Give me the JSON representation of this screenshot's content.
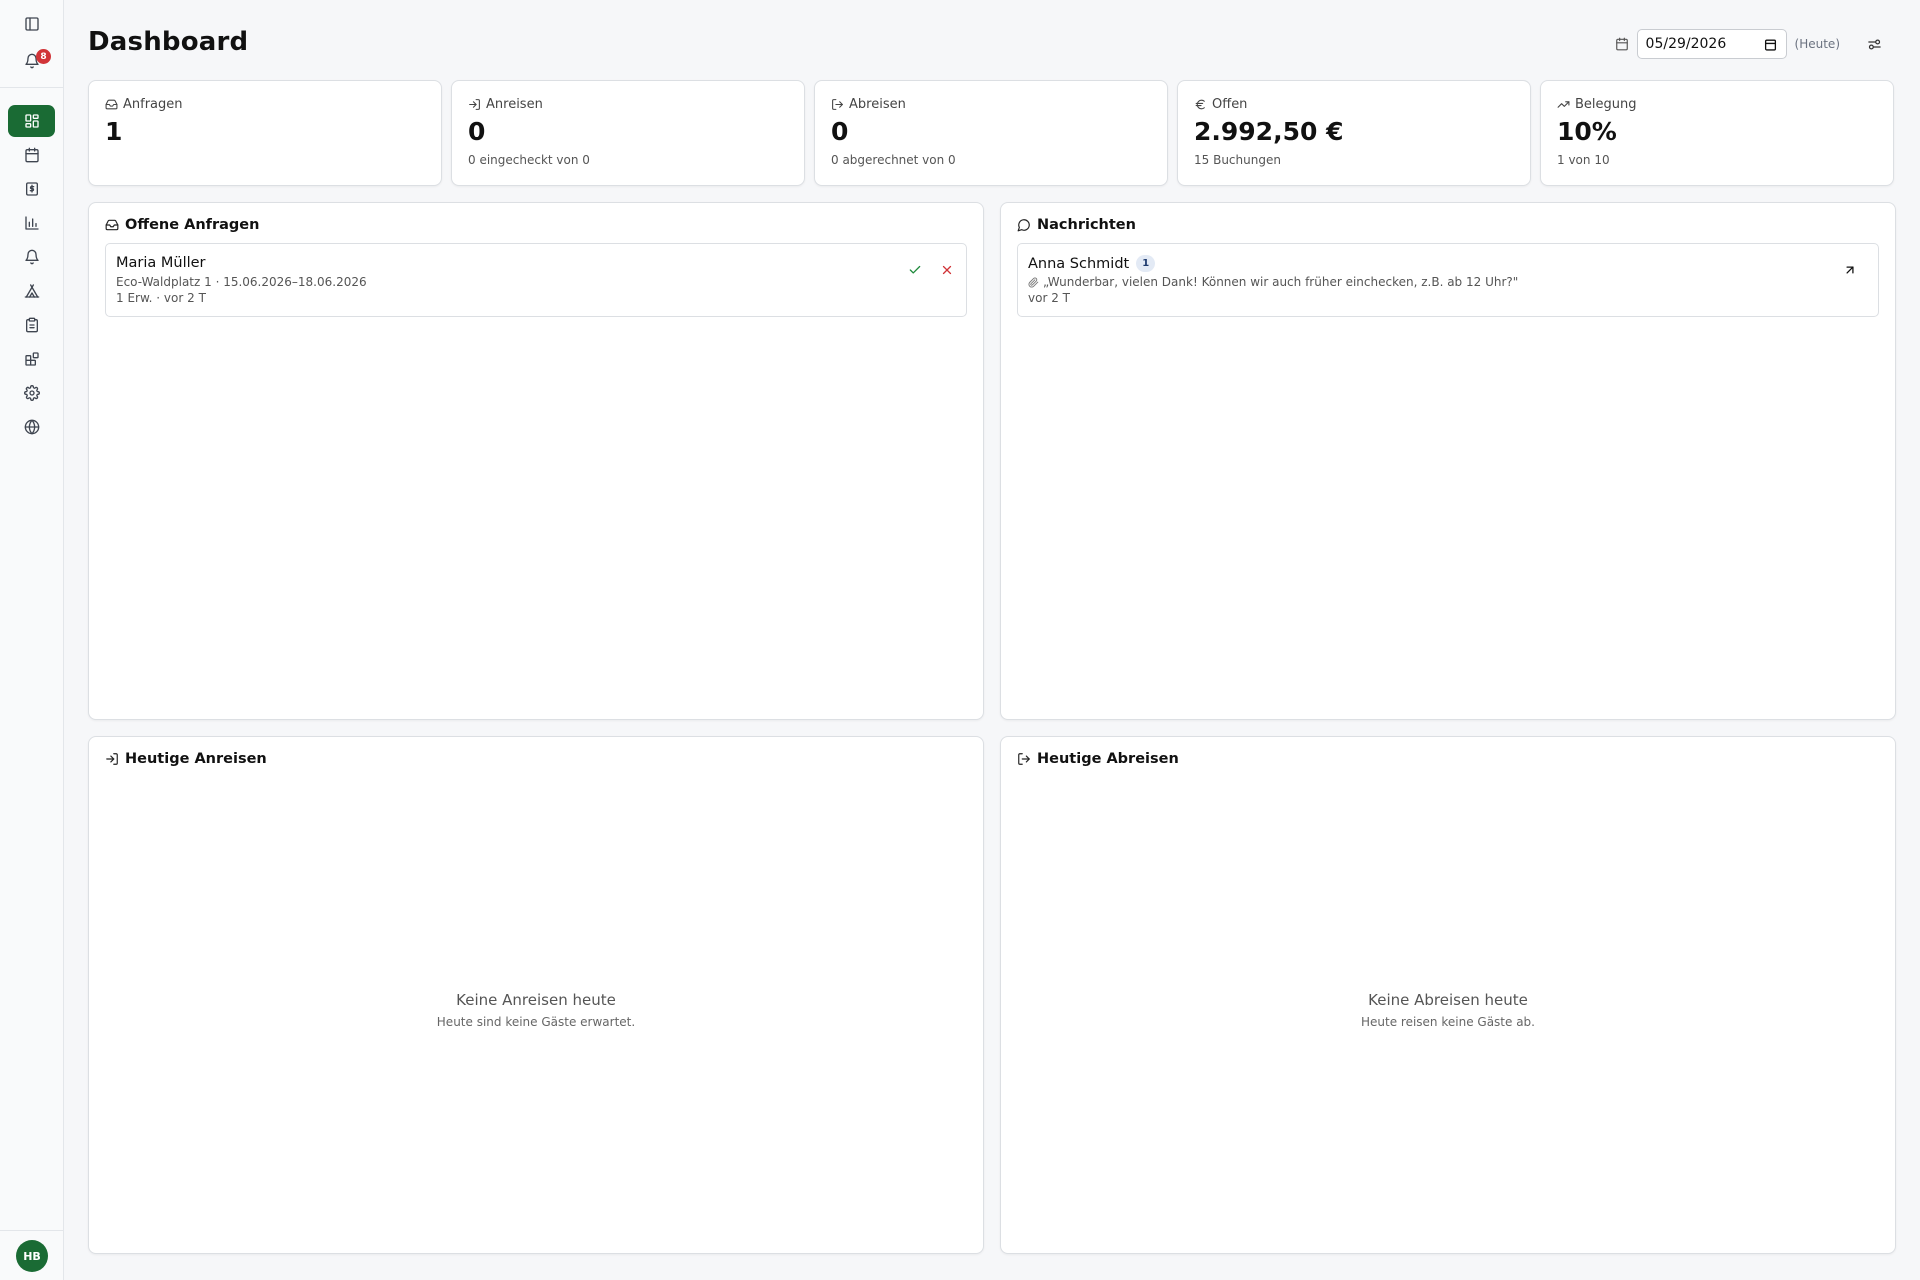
{
  "app": {
    "notification_count": "8",
    "user_initials": "HB",
    "accent_color": "#1a6b34"
  },
  "sidebar": {
    "items": [
      {
        "name": "dashboard",
        "icon": "grid-icon",
        "active": true
      },
      {
        "name": "calendar",
        "icon": "calendar-icon"
      },
      {
        "name": "billing",
        "icon": "dollar-document-icon"
      },
      {
        "name": "statistics",
        "icon": "bar-chart-icon"
      },
      {
        "name": "notifications",
        "icon": "bell-icon"
      },
      {
        "name": "campsite",
        "icon": "tent-icon"
      },
      {
        "name": "tasks",
        "icon": "clipboard-icon"
      },
      {
        "name": "integrations",
        "icon": "blocks-icon"
      },
      {
        "name": "settings",
        "icon": "gear-icon"
      },
      {
        "name": "website",
        "icon": "globe-icon"
      }
    ]
  },
  "header": {
    "title": "Dashboard",
    "date_value": "05/29/2026",
    "today_label": "(Heute)"
  },
  "stats": [
    {
      "label": "Anfragen",
      "icon": "inbox-icon",
      "value": "1",
      "sub": ""
    },
    {
      "label": "Anreisen",
      "icon": "log-in-icon",
      "value": "0",
      "sub": "0 eingecheckt von 0"
    },
    {
      "label": "Abreisen",
      "icon": "log-out-icon",
      "value": "0",
      "sub": "0 abgerechnet von 0"
    },
    {
      "label": "Offen",
      "icon": "euro-icon",
      "value": "2.992,50 €",
      "sub": "15 Buchungen"
    },
    {
      "label": "Belegung",
      "icon": "trending-up-icon",
      "value": "10%",
      "sub": "1 von 10"
    }
  ],
  "requests": {
    "title": "Offene Anfragen",
    "items": [
      {
        "name": "Maria Müller",
        "detail": "Eco-Waldplatz 1 · 15.06.2026–18.06.2026",
        "meta": "1 Erw. · vor 2 T"
      }
    ]
  },
  "messages": {
    "title": "Nachrichten",
    "items": [
      {
        "name": "Anna Schmidt",
        "unread": "1",
        "preview": "„Wunderbar, vielen Dank! Können wir auch früher einchecken, z.B. ab 12 Uhr?\"",
        "time": "vor 2 T"
      }
    ]
  },
  "arrivals": {
    "title": "Heutige Anreisen",
    "empty_title": "Keine Anreisen heute",
    "empty_sub": "Heute sind keine Gäste erwartet."
  },
  "departures": {
    "title": "Heutige Abreisen",
    "empty_title": "Keine Abreisen heute",
    "empty_sub": "Heute reisen keine Gäste ab."
  }
}
